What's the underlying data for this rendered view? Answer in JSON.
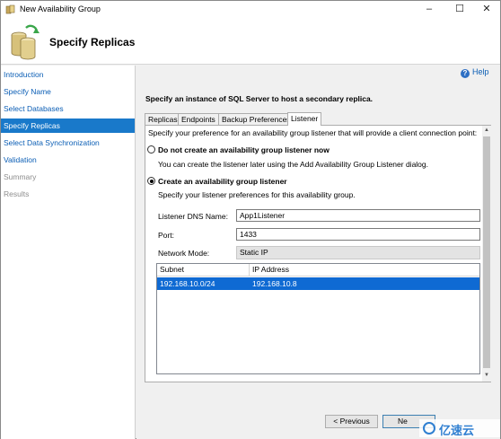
{
  "window": {
    "title": "New Availability Group",
    "minimize_glyph": "–",
    "maximize_glyph": "☐",
    "close_glyph": "✕"
  },
  "header": {
    "title": "Specify Replicas"
  },
  "nav": {
    "items": [
      {
        "label": "Introduction",
        "state": "link"
      },
      {
        "label": "Specify Name",
        "state": "link"
      },
      {
        "label": "Select Databases",
        "state": "link"
      },
      {
        "label": "Specify Replicas",
        "state": "active"
      },
      {
        "label": "Select Data Synchronization",
        "state": "link"
      },
      {
        "label": "Validation",
        "state": "link"
      },
      {
        "label": "Summary",
        "state": "disabled"
      },
      {
        "label": "Results",
        "state": "disabled"
      }
    ]
  },
  "main": {
    "help_label": "Help",
    "help_glyph": "?",
    "instruction": "Specify an instance of SQL Server to host a secondary replica.",
    "tabs": [
      {
        "label": "Replicas",
        "selected": false
      },
      {
        "label": "Endpoints",
        "selected": false
      },
      {
        "label": "Backup Preferences",
        "selected": false
      },
      {
        "label": "Listener",
        "selected": true
      }
    ],
    "listener": {
      "preference_text": "Specify your preference for an availability group listener that will provide a client connection point:",
      "option_none": {
        "label": "Do not create an availability group listener now",
        "description": "You can create the listener later using the Add Availability Group Listener dialog.",
        "checked": false
      },
      "option_create": {
        "label": "Create an availability group listener",
        "description": "Specify your listener preferences for this availability group.",
        "checked": true
      },
      "dns_name_label": "Listener DNS Name:",
      "dns_name_value": "App1Listener",
      "port_label": "Port:",
      "port_value": "1433",
      "network_mode_label": "Network Mode:",
      "network_mode_value": "Static IP",
      "grid": {
        "columns": [
          "Subnet",
          "IP Address"
        ],
        "rows": [
          {
            "subnet": "192.168.10.0/24",
            "ip": "192.168.10.8"
          }
        ]
      }
    },
    "scroll_up_glyph": "▲",
    "scroll_down_glyph": "▼"
  },
  "footer": {
    "previous_label": "< Previous",
    "next_label": "Ne"
  },
  "watermark": {
    "text": "亿速云"
  },
  "colors": {
    "nav_active": "#1979ca",
    "link": "#0b5eb5",
    "selection": "#0f6ad3"
  }
}
